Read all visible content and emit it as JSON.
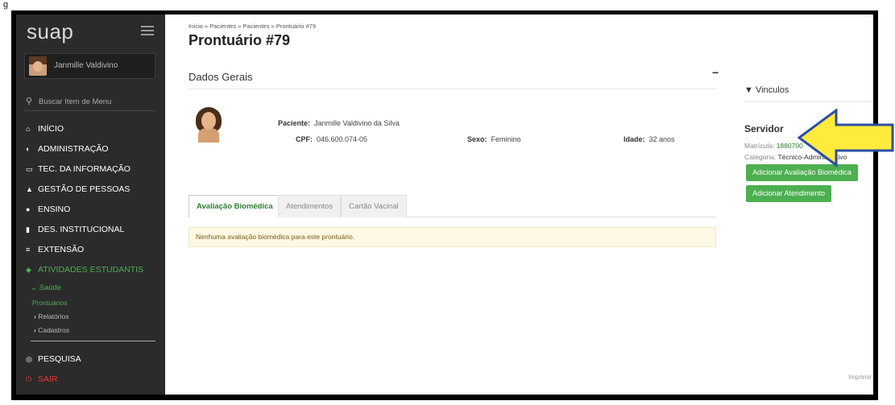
{
  "caption": "g",
  "sidebar": {
    "brand": "suap",
    "user_name": "Janmille Valdivino",
    "search_label": "Buscar Item de Menu",
    "items": [
      {
        "label": "INÍCIO",
        "icon": "home-icon",
        "glyph": "⌂"
      },
      {
        "label": "ADMINISTRAÇÃO",
        "icon": "admin-icon",
        "glyph": "◐"
      },
      {
        "label": "TEC. DA INFORMAÇÃO",
        "icon": "monitor-icon",
        "glyph": "▭"
      },
      {
        "label": "GESTÃO DE PESSOAS",
        "icon": "person-icon",
        "glyph": "▲"
      },
      {
        "label": "ENSINO",
        "icon": "ensino-icon",
        "glyph": "●"
      },
      {
        "label": "DES. INSTITUCIONAL",
        "icon": "bar-chart-icon",
        "glyph": "▮"
      },
      {
        "label": "EXTENSÃO",
        "icon": "extension-icon",
        "glyph": "≡"
      },
      {
        "label": "ATIVIDADES ESTUDANTIS",
        "icon": "graduation-cap-icon",
        "glyph": "◆"
      }
    ],
    "sub_saude": "Saúde",
    "sub_prontuarios": "Prontuários",
    "sub_relatorios": "Relatórios",
    "sub_cadastros": "Cadastros",
    "pesquisa": "PESQUISA",
    "sair": "SAIR",
    "active_color": "#4caf50",
    "logout_color": "#e53935"
  },
  "main": {
    "breadcrumb": "Início » Pacientes » Pacientes » Prontuário #79",
    "title": "Prontuário #79",
    "section_title": "Dados Gerais",
    "collapse_symbol": "−",
    "patient": {
      "paciente_label": "Paciente:",
      "paciente_value": "Janmille Valdivino da Silva",
      "cpf_label": "CPF:",
      "cpf_value": "046.600.074-05",
      "sexo_label": "Sexo:",
      "sexo_value": "Feminino",
      "idade_label": "Idade:",
      "idade_value": "32 anos"
    },
    "tabs": [
      "Avaliação Biomédica",
      "Atendimentos",
      "Cartão Vacinal"
    ],
    "active_tab": 0,
    "alert": "Nenhuma avaliação biomédica para este prontuário."
  },
  "right": {
    "vinculos_title": "▼ Vinculos",
    "servidor": "Servidor",
    "matricula_label": "Matrícula:",
    "matricula_value": "1880700",
    "categoria_label": "Categoria:",
    "categoria_value": "Técnico-Administrativo",
    "btn_avaliacao": "Adicionar Avaliação Biomédica",
    "btn_atendimento": "Adicionar Atendimento",
    "imprimir": "Imprimir"
  },
  "annotation": {
    "arrow_fill": "#ffeb3b",
    "arrow_stroke": "#2c4fa3"
  }
}
